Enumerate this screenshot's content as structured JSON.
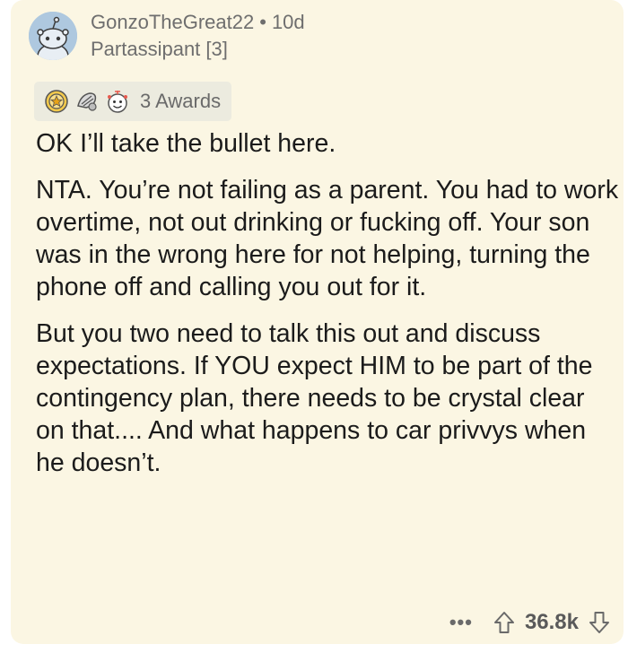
{
  "comment": {
    "username": "GonzoTheGreat22",
    "separator": "•",
    "age": "10d",
    "flair": "Partassipant [3]",
    "awards_label": "3 Awards",
    "paragraphs": [
      "OK I’ll take the bullet here.",
      "NTA. You’re not failing as a parent. You had to work overtime, not out drinking or fucking off. Your son was in the wrong here for not helping, turning the phone off and calling you out for it.",
      "But you two need to talk this out and discuss expectations. If YOU expect HIM to be part of the contingency plan, there needs to be crystal clear on that.... And what happens to car privvys when he doesn’t."
    ],
    "more": "•••",
    "score": "36.8k"
  },
  "colors": {
    "card_bg": "#fbf6e3",
    "award_bg": "#ecebdf",
    "text": "#1b1b1b",
    "meta": "#6e6e6e"
  },
  "icons": [
    "snoo-avatar",
    "award-icon",
    "award-icon",
    "award-icon",
    "more-icon",
    "upvote-icon",
    "downvote-icon"
  ]
}
